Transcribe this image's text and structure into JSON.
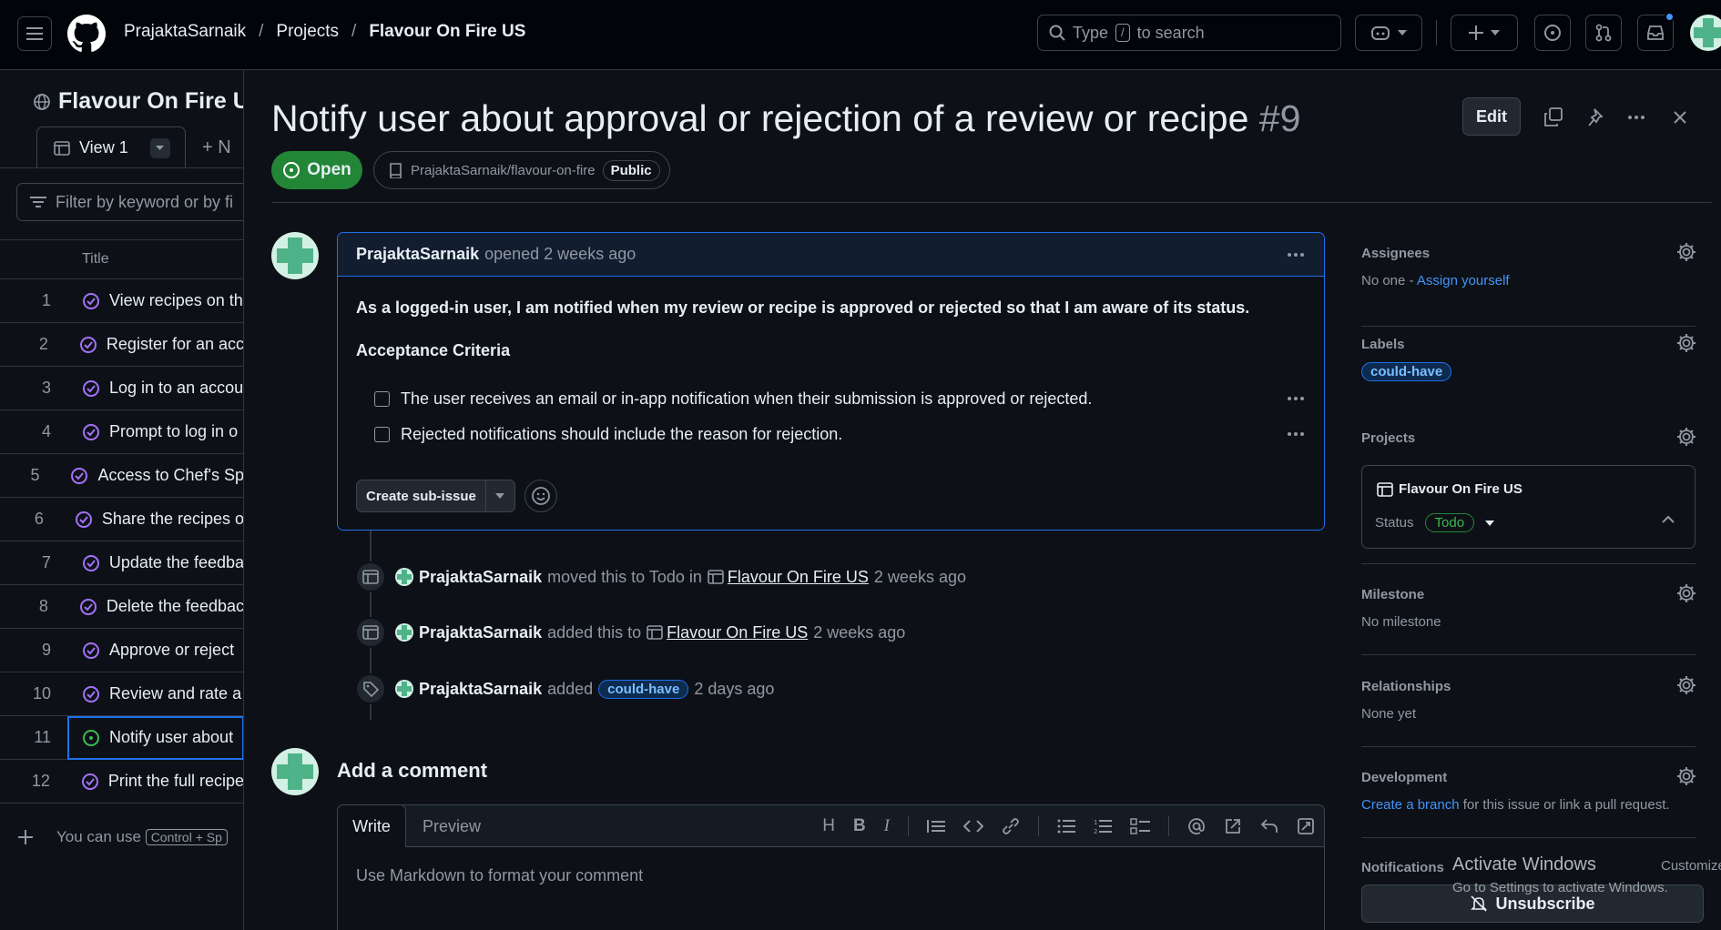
{
  "header": {
    "owner": "PrajaktaSarnaik",
    "projects": "Projects",
    "current": "Flavour On Fire US",
    "search_prefix": "Type",
    "search_key": "/",
    "search_suffix": "to search"
  },
  "project_table": {
    "title": "Flavour On Fire U",
    "view_tab": "View 1",
    "new_view": "+ N",
    "filter_placeholder": "Filter by keyword or by fi",
    "column_title": "Title",
    "rows": [
      {
        "num": "1",
        "title": "View recipes on th"
      },
      {
        "num": "2",
        "title": "Register for an acc"
      },
      {
        "num": "3",
        "title": "Log in to an accou"
      },
      {
        "num": "4",
        "title": "Prompt to log in o"
      },
      {
        "num": "5",
        "title": "Access to Chef's Sp"
      },
      {
        "num": "6",
        "title": "Share the recipes o"
      },
      {
        "num": "7",
        "title": "Update the feedba"
      },
      {
        "num": "8",
        "title": "Delete the feedbac"
      },
      {
        "num": "9",
        "title": "Approve or reject"
      },
      {
        "num": "10",
        "title": "Review and rate a"
      },
      {
        "num": "11",
        "title": "Notify user about"
      },
      {
        "num": "12",
        "title": "Print the full recipe"
      }
    ],
    "add_hint": "You can use",
    "add_kbd": "Control + Sp"
  },
  "issue": {
    "title": "Notify user about approval or rejection of a review or recipe",
    "number": "#9",
    "edit_label": "Edit",
    "state": "Open",
    "repo": "PrajaktaSarnaik/flavour-on-fire",
    "visibility": "Public",
    "author": "PrajaktaSarnaik",
    "opened": "opened 2 weeks ago",
    "body_lead": "As a logged-in user, I am notified when my review or recipe is approved or rejected so that I am aware of its status.",
    "criteria_heading": "Acceptance Criteria",
    "tasks": [
      "The user receives an email or in-app notification when their submission is approved or rejected.",
      "Rejected notifications should include the reason for rejection."
    ],
    "create_sub_issue": "Create sub-issue"
  },
  "timeline": [
    {
      "user": "PrajaktaSarnaik",
      "action": "moved this to Todo in",
      "target": "Flavour On Fire US",
      "time": "2 weeks ago"
    },
    {
      "user": "PrajaktaSarnaik",
      "action": "added this to",
      "target": "Flavour On Fire US",
      "time": "2 weeks ago"
    },
    {
      "user": "PrajaktaSarnaik",
      "action": "added",
      "label": "could-have",
      "time": "2 days ago"
    }
  ],
  "comment_box": {
    "heading": "Add a comment",
    "write_tab": "Write",
    "preview_tab": "Preview",
    "placeholder": "Use Markdown to format your comment"
  },
  "sidebar": {
    "assignees_title": "Assignees",
    "assignees_none": "No one -",
    "assign_yourself": "Assign yourself",
    "labels_title": "Labels",
    "label": "could-have",
    "projects_title": "Projects",
    "project_name": "Flavour On Fire US",
    "status_label": "Status",
    "status_value": "Todo",
    "milestone_title": "Milestone",
    "milestone_value": "No milestone",
    "relationships_title": "Relationships",
    "relationships_value": "None yet",
    "development_title": "Development",
    "create_branch": "Create a branch",
    "development_rest": "for this issue or link a pull request.",
    "notifications_title": "Notifications",
    "customize": "Customize",
    "unsubscribe": "Unsubscribe"
  },
  "watermark": {
    "line1": "Activate Windows",
    "line2": "Go to Settings to activate Windows."
  },
  "colors": {
    "accent": "#1f6feb",
    "open": "#238636",
    "bg": "#0d1117"
  }
}
